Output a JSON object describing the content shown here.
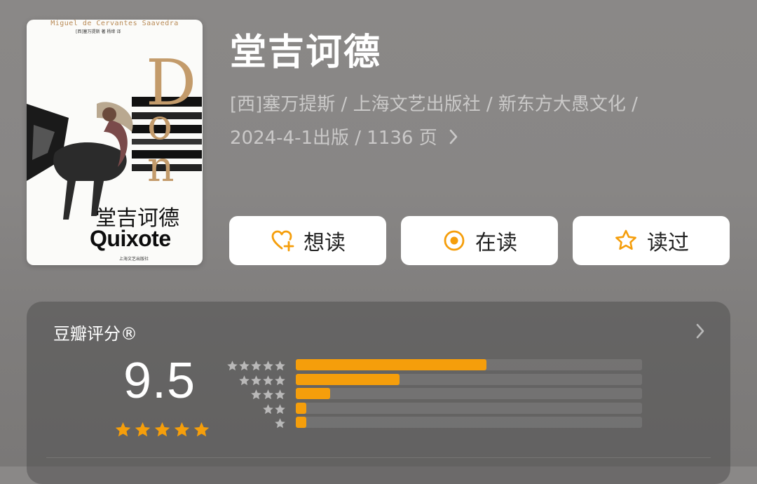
{
  "cover": {
    "author_en": "Miguel de Cervantes Saavedra",
    "credit": "[西]塞万提斯 著  杨绛 译",
    "big_letter": "D",
    "on_letter_1": "o",
    "on_letter_2": "n",
    "title_zh": "堂吉诃德",
    "title_en": "Quixote",
    "publisher_mark": "上海文艺出版社"
  },
  "book": {
    "title": "堂吉诃德",
    "meta_line1": "[西]塞万提斯 / 上海文艺出版社 / 新东方大愚文化 /",
    "meta_line2": "2024-4-1出版 / 1136 页"
  },
  "actions": [
    {
      "label": "想读",
      "icon": "heart-plus-icon"
    },
    {
      "label": "在读",
      "icon": "radio-dot-icon"
    },
    {
      "label": "读过",
      "icon": "star-outline-icon"
    }
  ],
  "rating": {
    "heading": "豆瓣评分®",
    "score": "9.5",
    "stars_filled": 5,
    "distribution": [
      {
        "stars": 5,
        "fraction": 0.55
      },
      {
        "stars": 4,
        "fraction": 0.3
      },
      {
        "stars": 3,
        "fraction": 0.1
      },
      {
        "stars": 2,
        "fraction": 0.03
      },
      {
        "stars": 1,
        "fraction": 0.03
      }
    ]
  },
  "colors": {
    "accent": "#f59e0b",
    "button_bg": "#ffffff",
    "card_bg": "#5b5a5b"
  }
}
